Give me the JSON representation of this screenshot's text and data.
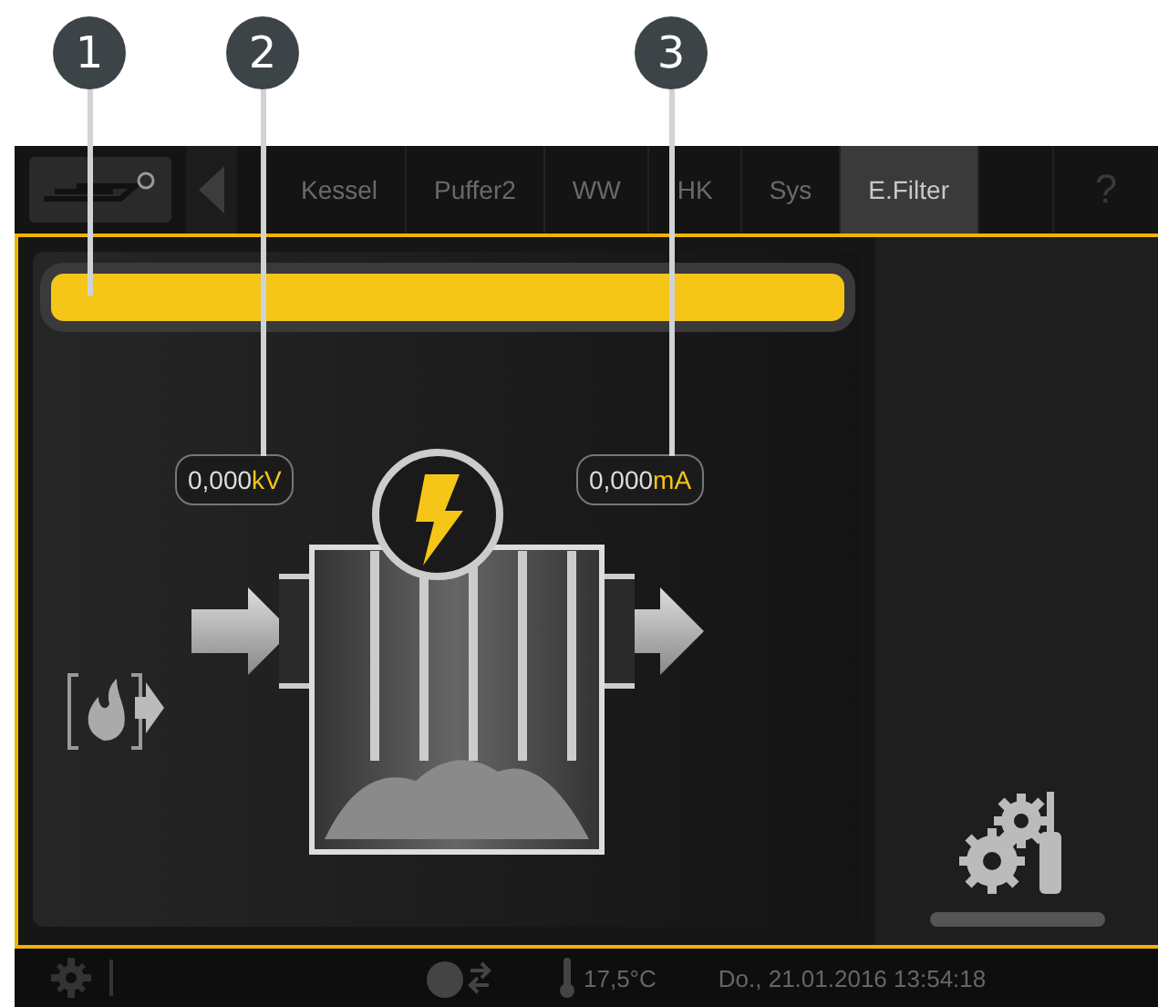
{
  "callouts": [
    {
      "number": "1"
    },
    {
      "number": "2"
    },
    {
      "number": "3"
    }
  ],
  "tabs": [
    {
      "label": "Kessel",
      "selected": false
    },
    {
      "label": "Puffer2",
      "selected": false
    },
    {
      "label": "WW",
      "selected": false
    },
    {
      "label": "HK",
      "selected": false
    },
    {
      "label": "Sys",
      "selected": false
    },
    {
      "label": "E.Filter",
      "selected": true
    }
  ],
  "help_button": "?",
  "readings": [
    {
      "value": "0,000",
      "unit": "kV"
    },
    {
      "value": "0,000",
      "unit": "mA"
    }
  ],
  "status_bar": {
    "temperature": "17,5°C",
    "datetime": "Do., 21.01.2016 13:54:18"
  }
}
